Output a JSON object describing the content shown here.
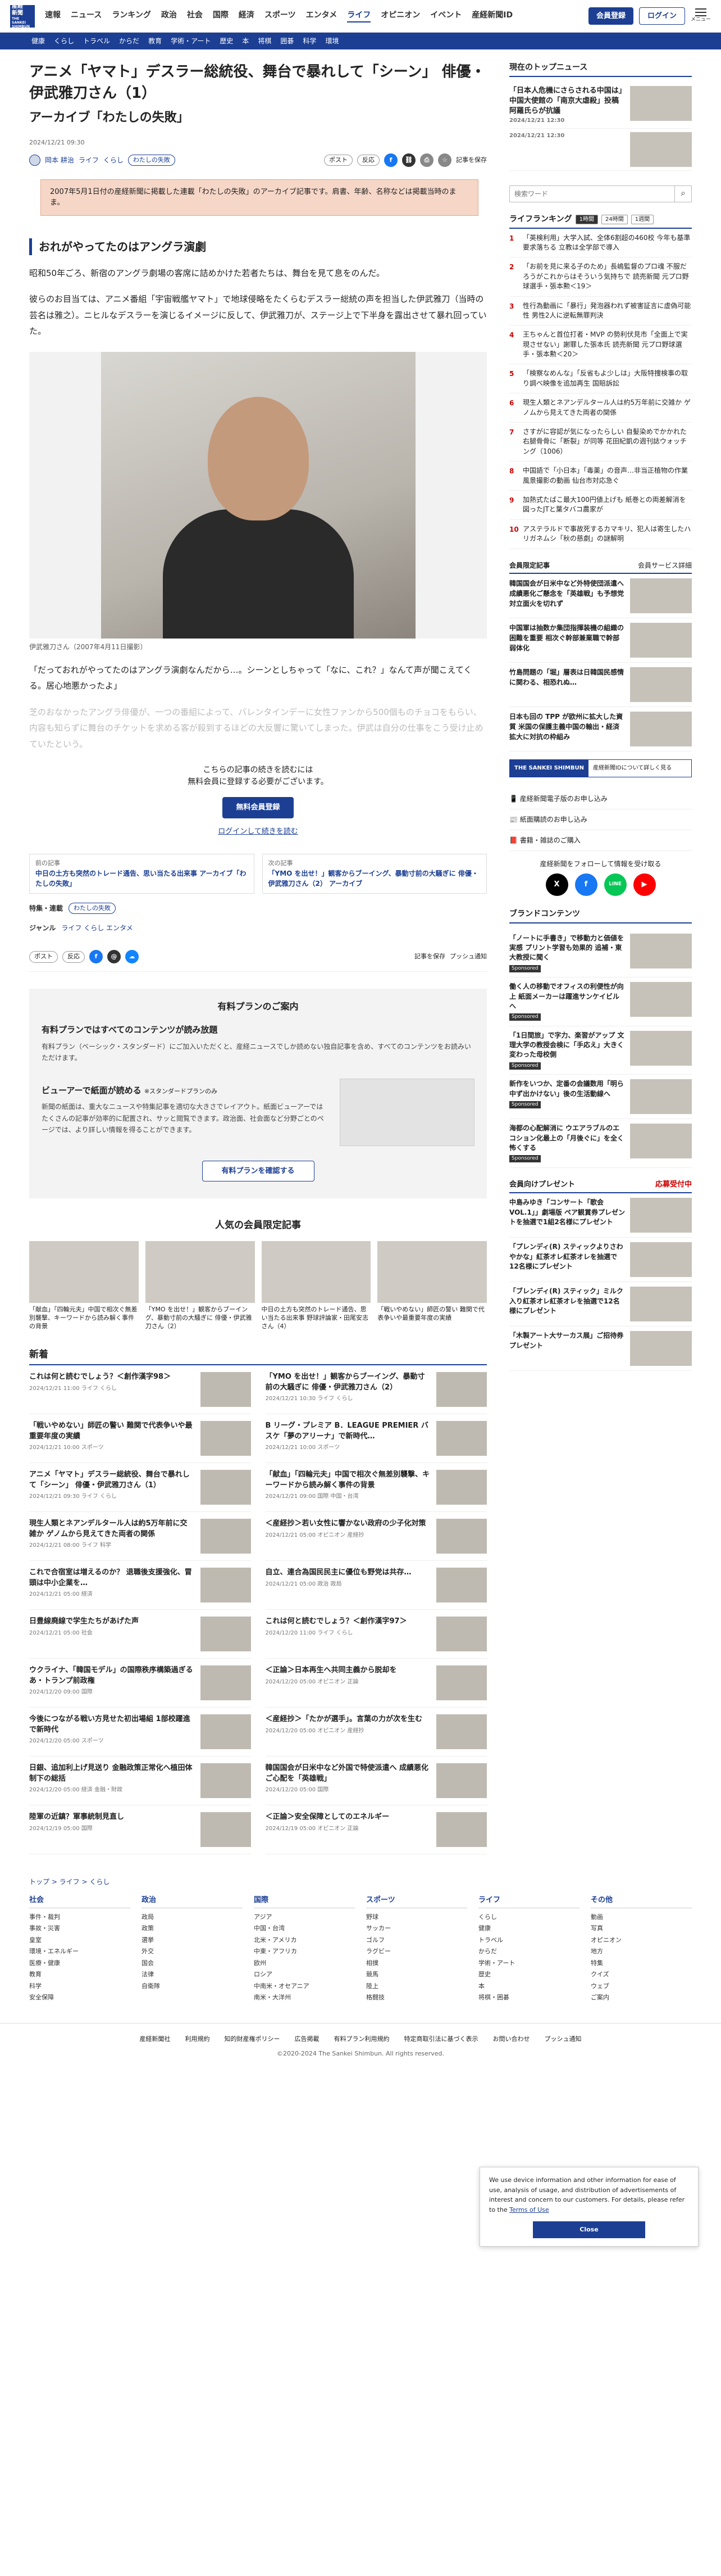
{
  "header": {
    "logo_line1": "産経",
    "logo_line2": "新聞",
    "logo_en": "THE SANKEI SHIMBUN",
    "nav": [
      "速報",
      "ニュース",
      "ランキング",
      "政治",
      "社会",
      "国際",
      "経済",
      "スポーツ",
      "エンタメ",
      "ライフ",
      "オピニオン",
      "イベント",
      "産経新聞ID"
    ],
    "register": "会員登録",
    "login": "ログイン",
    "menu": "メニュー",
    "subnav": [
      "健康",
      "くらし",
      "トラベル",
      "からだ",
      "教育",
      "学術・アート",
      "歴史",
      "本",
      "将棋",
      "囲碁",
      "科学",
      "環境"
    ]
  },
  "article": {
    "title": "アニメ「ヤマト」デスラー総統役、舞台で暴れして「シーン」 俳優・伊武雅刀さん（1）",
    "subtitle": "アーカイブ「わたしの失敗」",
    "date": "2024/12/21 09:30",
    "author": "岡本 耕治",
    "category": "ライフ",
    "category2": "くらし",
    "tag": "わたしの失敗",
    "post": "ポスト",
    "reaction": "反応",
    "save": "記事を保存",
    "note": "2007年5月1日付の産経新聞に掲載した連載「わたしの失敗」のアーカイブ記事です。肩書、年齢、名称などは掲載当時のまま。",
    "section": "おれがやってたのはアングラ演劇",
    "p1": "昭和50年ごろ、新宿のアングラ劇場の客席に詰めかけた若者たちは、舞台を見て息をのんだ。",
    "p2": "彼らのお目当ては、アニメ番組「宇宙戦艦ヤマト」で地球侵略をたくらむデスラー総統の声を担当した伊武雅刀（当時の芸名は雅之）。ニヒルなデスラーを演じるイメージに反して、伊武雅刀が、ステージ上で下半身を露出させて暴れ回っていた。",
    "caption": "伊武雅刀さん（2007年4月11日撮影）",
    "p3": "「だっておれがやってたのはアングラ演劇なんだから…。シーンとしちゃって「なに、これ？」なんて声が聞こえてくる。居心地悪かったよ」",
    "p4": "芝のおなかったアングラ俳優が、一つの番組によって、バレンタインデーに女性ファンから500個ものチョコをもらい、内容も知らずに舞台のチケットを求める客が殺到するほどの大反響に驚いてしまった。伊武は自分の仕事をこう受け止めていたという。",
    "paywall1": "こちらの記事の続きを読むには",
    "paywall2": "無料会員に登録する必要がございます。",
    "paywall_btn": "無料会員登録",
    "paywall_link": "ログインして続きを読む",
    "prev_label": "前の記事",
    "prev_text": "中日の土方も突然のトレード通告、思い当たる出来事 アーカイブ「わたしの失敗」",
    "next_label": "次の記事",
    "next_text": "「YMO を出せ！」観客からブーイング、暴動寸前の大騒ぎに 俳優・伊武雅刀さん（2） アーカイブ",
    "feature_label": "特集・連載",
    "feature_value": "わたしの失敗",
    "genre_label": "ジャンル",
    "genre_value": "ライフ くらし エンタメ",
    "push": "プッシュ通知"
  },
  "plan": {
    "title": "有料プランのご案内",
    "h1": "有料プランではすべてのコンテンツが読み放題",
    "p1": "有料プラン（ベーシック・スタンダード）にご加入いただくと、産経ニュースでしか読めない独自記事を含め、すべてのコンテンツをお読みいただけます。",
    "h2": "ビューアーで紙面が読める",
    "h2_tag": "※スタンダードプランのみ",
    "p2": "新聞の紙面は、重大なニュースや特集記事を適切な大きさでレイアウト。紙面ビューアーではたくさんの記事が効率的に配置され、サッと閲覧できます。政治面、社会面など分野ごとのページでは、より詳しい情報を得ることができます。",
    "btn": "有料プランを確認する"
  },
  "popular": {
    "title": "人気の会員限定記事",
    "items": [
      "「献血」「四輪元夫」中国で相次ぐ無差別襲撃、キーワードから読み解く事件の背景",
      "「YMO を出せ！」観客からブーイング、暴動寸前の大騒ぎに 俳優・伊武雅刀さん（2）",
      "中日の土方も突然のトレード通告、思い当たる出来事 野球評論家・田尾安志さん（4）",
      "「戦いやめない」師匠の警い 難関で代表争いや最重要年度の実績"
    ]
  },
  "news": {
    "title": "新着",
    "items": [
      {
        "t": "これは何と読むでしょう？＜創作漢字98＞",
        "d": "2024/12/21 11:00 ライフ くらし"
      },
      {
        "t": "「YMO を出せ！」観客からブーイング、暴動寸前の大騒ぎに 俳優・伊武雅刀さん（2）",
        "d": "2024/12/21 10:30 ライフ くらし"
      },
      {
        "t": "「戦いやめない」師匠の警い 難関で代表争いや最重要年度の実績",
        "d": "2024/12/21 10:00 スポーツ"
      },
      {
        "t": "B リーグ・プレミア B．LEAGUE PREMIER バスケ「夢のアリーナ」で新時代…",
        "d": "2024/12/21 10:00 スポーツ"
      },
      {
        "t": "アニメ「ヤマト」デスラー総統役、舞台で暴れして「シーン」 俳優・伊武雅刀さん（1）",
        "d": "2024/12/21 09:30 ライフ くらし"
      },
      {
        "t": "「献血」「四輪元夫」中国で相次ぐ無差別襲撃、キーワードから読み解く事件の背景",
        "d": "2024/12/21 09:00 国際 中国・台湾"
      },
      {
        "t": "現生人類とネアンデルタール人は約5万年前に交雑か ゲノムから見えてきた両者の関係",
        "d": "2024/12/21 08:00 ライフ 科学"
      },
      {
        "t": "＜産経抄＞若い女性に響かない政府の少子化対策",
        "d": "2024/12/21 05:00 オピニオン 産経抄"
      },
      {
        "t": "これで合宿室は増えるのか？ 退職後支援強化、冒頭は中小企業を…",
        "d": "2024/12/21 05:00 経済"
      },
      {
        "t": "自立、連合為国民民主に優位も野党は共存…",
        "d": "2024/12/21 05:00 政治 政局"
      },
      {
        "t": "日豊線廃線で学生たちがあげた声",
        "d": "2024/12/21 05:00 社会"
      },
      {
        "t": "これは何と読むでしょう？＜創作漢字97＞",
        "d": "2024/12/20 11:00 ライフ くらし"
      },
      {
        "t": "ウクライナ、「韓国モデル」の国際秩序構築過ぎる あ・トランプ前政権",
        "d": "2024/12/20 09:00 国際"
      },
      {
        "t": "＜正論＞日本再生へ共同主義から脱却を",
        "d": "2024/12/20 05:00 オピニオン 正論"
      },
      {
        "t": "今後につながる戦い方見せた初出場組 1部校躍進で新時代",
        "d": "2024/12/20 05:00 スポーツ"
      },
      {
        "t": "＜産経抄＞「たかが選手」。言葉の力が次を生む",
        "d": "2024/12/20 05:00 オピニオン 産経抄"
      },
      {
        "t": "日銀、追加利上げ見送り 金融政策正常化へ植田体制下の総括",
        "d": "2024/12/20 05:00 経済 金融・財政"
      },
      {
        "t": "韓国国会が日米中など外国で特使派遣へ 成績悪化ご心配を「英雄戦」",
        "d": "2024/12/20 05:00 国際"
      },
      {
        "t": "陸軍の近鎮？軍事統制見直し",
        "d": "2024/12/19 05:00 国際"
      },
      {
        "t": "＜正論＞安全保障としてのエネルギー",
        "d": "2024/12/19 05:00 オピニオン 正論"
      }
    ]
  },
  "side": {
    "top_title": "現在のトップニュース",
    "top_items": [
      {
        "t": "「日本人危機にさらされる中国は」中国大使館の「南京大虐殺」投稿 阿羅氏らが抗議",
        "d": "2024/12/21 12:30"
      },
      {
        "t": "",
        "d": "2024/12/21 12:30"
      }
    ],
    "search_placeholder": "検索ワード",
    "rank_title": "ライフランキング",
    "rank_tabs": [
      "1時間",
      "24時間",
      "1週間"
    ],
    "rank": [
      "「英検利用」大学入試、全体6割超の460校 今年も基準要求落ちる 立教は全学部で導入",
      "「お前を見に来る子のため」長嶋監督のプロ魂 不服だろうがこれからはそういう気持ちで 読売新聞 元プロ野球選手・張本勲＜19＞",
      "性行為動画に「暴行」発泡器われず被害証言に虚偽可能性 男性2人に逆転無罪判決",
      "王ちゃんと首位打者・MVP の勢利伏見市「全面上で実現させない」謝罪した張本氏 読売新聞 元プロ野球選手・張本勲＜20＞",
      "「検察なめんな」「反省もよ少しは」大阪特捜検事の取り調べ映像を追加再生 国賠訴訟",
      "現生人類とネアンデルタール人は約5万年前に交雑か ゲノムから見えてきた両者の関係",
      "さすがに容認が気になったらしい 自髪染めでかかれた右腿骨骨に「断裂」が同等 花田紀凱の週刊誌ウォッチング（1006）",
      "中国語で「小日本」「毒薬」の音声…非当正植物の作業風景撮影の動画 仙台市対応急ぐ",
      "加熱式たばこ最大100円値上げも 紙巻との両差解消を図ったJTと葉タバコ農家が",
      "アステラルドで事故死するカマキリ、犯人は寄生したハリガネムシ「秋の慈劇」の謎解明"
    ],
    "svc_title": "会員限定記事",
    "svc_link": "会員サービス詳細",
    "svc": [
      "韓国国会が日米中など外特使団派遣へ 成績悪化ご懸念を「英雄戦」も予想党対立面火を切れず",
      "中国軍は抽数か集団指揮装機の組織の困難を重要 相次ぐ幹部兼業職で幹部弱体化",
      "竹島問題の「堀」層表は日韓国民感情に関わる、相恐れぬ…",
      "日本も回の TPP が欧州に拡大した資質 米国の保護主義中国の輸出・経済拡大に対抗の枠組み"
    ],
    "banner_b": "THE SANKEI SHIMBUN",
    "banner_t": "産経新聞IDについて詳しく見る",
    "links": [
      "産経新聞電子版のお申し込み",
      "紙面購読のお申し込み",
      "書籍・雑誌のご購入"
    ],
    "follow": "産経新聞をフォローして情報を受け取る",
    "follow_icons": [
      "X",
      "f",
      "LINE",
      "▶"
    ],
    "brand_title": "ブランドコンテンツ",
    "brand": [
      "「ノートに手書き」で移動力と価値を実感 プリント学習も効果的 追補・東大教授に聞く",
      "働く人の移動でオフィスの利便性が向上 紙面メーカーは躍進サンケイビルへ",
      "「1日間旅」で字力、楽習がアップ 文理大学の教授会検に「手応え」大きく変わった母校側",
      "新作をいつか、定番の会議数用「明ら中ず出かけない」後の生活動線へ",
      "海都の心配解消に ウエアラブルのエコション化最上の「月後ぐに」を全く怖くする"
    ],
    "sponsored": "Sponsored",
    "present_title": "会員向けプレゼント",
    "present_link": "応募受付中",
    "present": [
      "中島みゆき「コンサート「歌会VOL.1」」劇場版 ペア観賞券プレゼントを抽選で1組2名様にプレゼント",
      "「プレンディ(R) スティックよりさわやかな」紅茶オレ紅茶オレを抽選で12名様にプレゼント",
      "「ブレンディ(R) スティック」ミルク入り紅茶オレ紅茶オレを抽選で12名様にプレゼント",
      "「木製アート大サーカス展」ご招待券プレゼント"
    ]
  },
  "cookie": {
    "text": "We use device information and other information for ease of use, analysis of usage, and distribution of advertisements of interest and concern to our customers. For details, please refer to the",
    "link": "Terms of Use",
    "close": "Close"
  },
  "footer": {
    "crumbs": "トップ > ライフ > くらし",
    "cols": [
      {
        "h": "社会",
        "items": [
          "事件・裁判",
          "事故・災害",
          "皇室",
          "環境・エネルギー",
          "医療・健康",
          "教育",
          "科学",
          "安全保障"
        ]
      },
      {
        "h": "政治",
        "items": [
          "政局",
          "政策",
          "選挙",
          "外交",
          "国会",
          "法律",
          "自衛隊"
        ]
      },
      {
        "h": "国際",
        "items": [
          "アジア",
          "中国・台湾",
          "北米・アメリカ",
          "中東・アフリカ",
          "欧州",
          "ロシア",
          "中南米・オセアニア",
          "南米・大洋州"
        ]
      },
      {
        "h": "スポーツ",
        "items": [
          "野球",
          "サッカー",
          "ゴルフ",
          "ラグビー",
          "相撲",
          "競馬",
          "陸上",
          "格闘技"
        ]
      },
      {
        "h": "ライフ",
        "items": [
          "くらし",
          "健康",
          "トラベル",
          "からだ",
          "学術・アート",
          "歴史",
          "本",
          "将棋・囲碁"
        ]
      },
      {
        "h": "その他",
        "items": [
          "動画",
          "写真",
          "オピニオン",
          "地方",
          "特集",
          "クイズ",
          "ウェブ",
          "ご案内"
        ]
      }
    ],
    "bottom": [
      "産経新聞社",
      "利用規約",
      "知的財産権ポリシー",
      "広告掲載",
      "有料プラン利用規約",
      "特定商取引法に基づく表示",
      "お問い合わせ",
      "プッシュ通知"
    ],
    "copyright": "©2020-2024 The Sankei Shimbun. All rights reserved."
  }
}
